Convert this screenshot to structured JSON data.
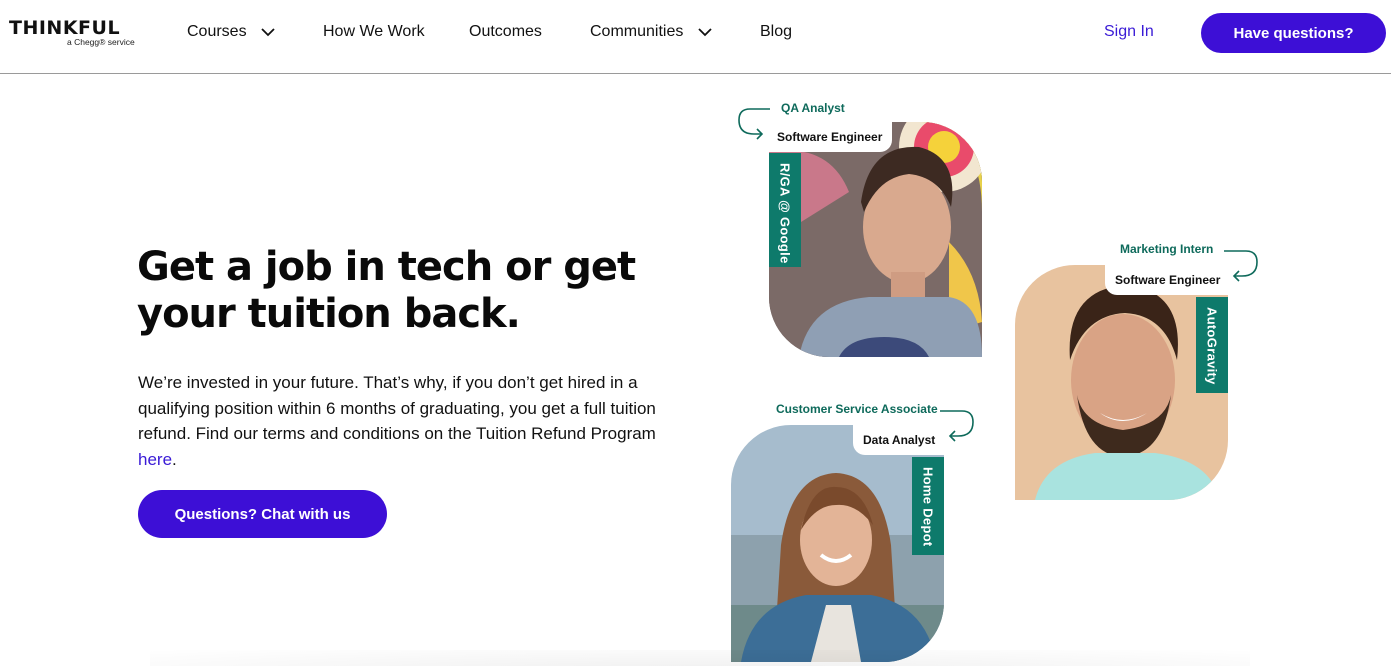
{
  "header": {
    "logo": "THINKFUL",
    "logo_sub": "a Chegg® service",
    "nav": [
      {
        "label": "Courses"
      },
      {
        "label": "How We Work"
      },
      {
        "label": "Outcomes"
      },
      {
        "label": "Communities"
      },
      {
        "label": "Blog"
      }
    ],
    "sign_in": "Sign In",
    "cta": "Have questions?"
  },
  "hero": {
    "headline": "Get a job in tech or get your tuition back.",
    "body_before_link": "We’re invested in your future. That’s why, if you don’t get hired in a qualifying position within 6 months of graduating, you get a full tuition refund. Find our terms and conditions on the Tuition Refund Program ",
    "link": "here",
    "body_after_link": ".",
    "chat_button": "Questions? Chat with us"
  },
  "cards": [
    {
      "old_role": "QA Analyst",
      "new_role": "Software Engineer",
      "company": "R/GA @ Google"
    },
    {
      "old_role": "Marketing Intern",
      "new_role": "Software Engineer",
      "company": "AutoGravity"
    },
    {
      "old_role": "Customer Service Associate",
      "new_role": "Data Analyst",
      "company": "Home Depot"
    }
  ],
  "colors": {
    "brand": "#3d0fd6",
    "link": "#3a1bd6",
    "teal": "#0e7a6b"
  }
}
